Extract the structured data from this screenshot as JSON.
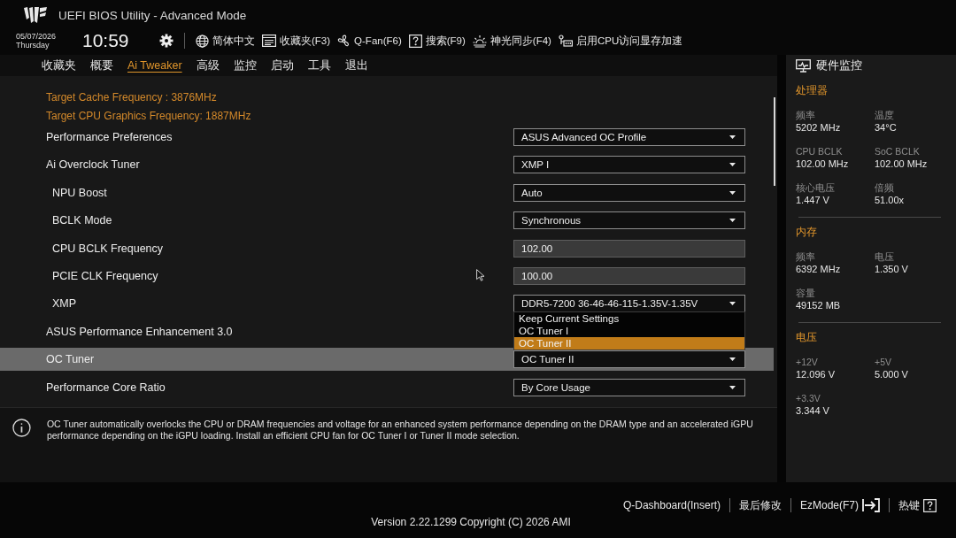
{
  "header": {
    "title": "UEFI BIOS Utility - Advanced Mode",
    "date": "05/07/2026",
    "weekday": "Thursday",
    "time": "10:59",
    "toolbar": [
      {
        "kind": "language",
        "label": "简体中文"
      },
      {
        "kind": "favorites",
        "label": "收藏夹(F3)"
      },
      {
        "kind": "qfan",
        "label": "Q-Fan(F6)"
      },
      {
        "kind": "search",
        "label": "搜索(F9)"
      },
      {
        "kind": "lighting",
        "label": "神光同步(F4)"
      },
      {
        "kind": "memory",
        "label": "启用CPU访问显存加速"
      }
    ]
  },
  "tabs": [
    {
      "label": "收藏夹",
      "selected": false
    },
    {
      "label": "概要",
      "selected": false
    },
    {
      "label": "Ai Tweaker",
      "selected": true
    },
    {
      "label": "高级",
      "selected": false
    },
    {
      "label": "监控",
      "selected": false
    },
    {
      "label": "启动",
      "selected": false
    },
    {
      "label": "工具",
      "selected": false
    },
    {
      "label": "退出",
      "selected": false
    }
  ],
  "settings": {
    "info_lines": [
      "Target Cache Frequency : 3876MHz",
      "Target CPU Graphics Frequency: 1887MHz"
    ],
    "rows": [
      {
        "label": "Performance Preferences",
        "selected": false,
        "control": {
          "kind": "select",
          "value": "ASUS Advanced OC Profile"
        }
      },
      {
        "label": "Ai Overclock Tuner",
        "selected": false,
        "control": {
          "kind": "select",
          "value": "XMP I"
        },
        "children": [
          {
            "label": "NPU Boost",
            "selected": false,
            "control": {
              "kind": "select",
              "value": "Auto"
            }
          },
          {
            "label": "BCLK Mode",
            "selected": false,
            "control": {
              "kind": "select",
              "value": "Synchronous"
            }
          },
          {
            "label": "CPU BCLK Frequency",
            "selected": false,
            "control": {
              "kind": "input",
              "value": "102.00"
            }
          },
          {
            "label": "PCIE CLK Frequency",
            "selected": false,
            "control": {
              "kind": "input",
              "value": "100.00"
            }
          },
          {
            "label": "XMP",
            "selected": false,
            "control": {
              "kind": "select",
              "value": "DDR5-7200 36-46-46-115-1.35V-1.35V"
            }
          }
        ]
      },
      {
        "label": "ASUS Performance Enhancement 3.0",
        "selected": false
      },
      {
        "label": "OC Tuner",
        "selected": true,
        "control": {
          "kind": "select",
          "value": "OC Tuner II",
          "expanded": true,
          "options": [
            {
              "label": "Keep Current Settings",
              "selected": false
            },
            {
              "label": "OC Tuner I",
              "selected": false
            },
            {
              "label": "OC Tuner II",
              "selected": true
            }
          ]
        }
      },
      {
        "label": "Performance Core Ratio",
        "selected": false,
        "control": {
          "kind": "select",
          "value": "By Core Usage"
        }
      }
    ]
  },
  "help": {
    "text": "OC Tuner automatically overlocks the CPU or DRAM frequencies and voltage for an enhanced system performance depending on the DRAM type and an accelerated iGPU performance depending on the iGPU loading. Install an efficient CPU fan for OC Tuner I or Tuner II mode selection."
  },
  "hardware_monitor": {
    "title": "硬件监控",
    "sections": [
      {
        "title": "处理器",
        "items": [
          {
            "label": "频率",
            "value": "5202 MHz"
          },
          {
            "label": "温度",
            "value": "34°C"
          },
          {
            "label": "CPU BCLK",
            "value": "102.00 MHz"
          },
          {
            "label": "SoC BCLK",
            "value": "102.00 MHz"
          },
          {
            "label": "核心电压",
            "value": "1.447 V"
          },
          {
            "label": "倍频",
            "value": "51.00x"
          }
        ]
      },
      {
        "title": "内存",
        "items": [
          {
            "label": "频率",
            "value": "6392 MHz"
          },
          {
            "label": "电压",
            "value": "1.350 V"
          },
          {
            "label": "容量",
            "value": "49152 MB"
          }
        ]
      },
      {
        "title": "电压",
        "items": [
          {
            "label": "+12V",
            "value": "12.096 V"
          },
          {
            "label": "+5V",
            "value": "5.000 V"
          },
          {
            "label": "+3.3V",
            "value": "3.344 V"
          }
        ]
      }
    ]
  },
  "footer": {
    "actions": [
      {
        "kind": "text",
        "label": "Q-Dashboard(Insert)"
      },
      {
        "kind": "text",
        "label": "最后修改"
      },
      {
        "kind": "exit",
        "label": "EzMode(F7)"
      },
      {
        "kind": "help",
        "label": "热键"
      }
    ],
    "version": "Version 2.22.1299 Copyright (C) 2026 AMI"
  }
}
